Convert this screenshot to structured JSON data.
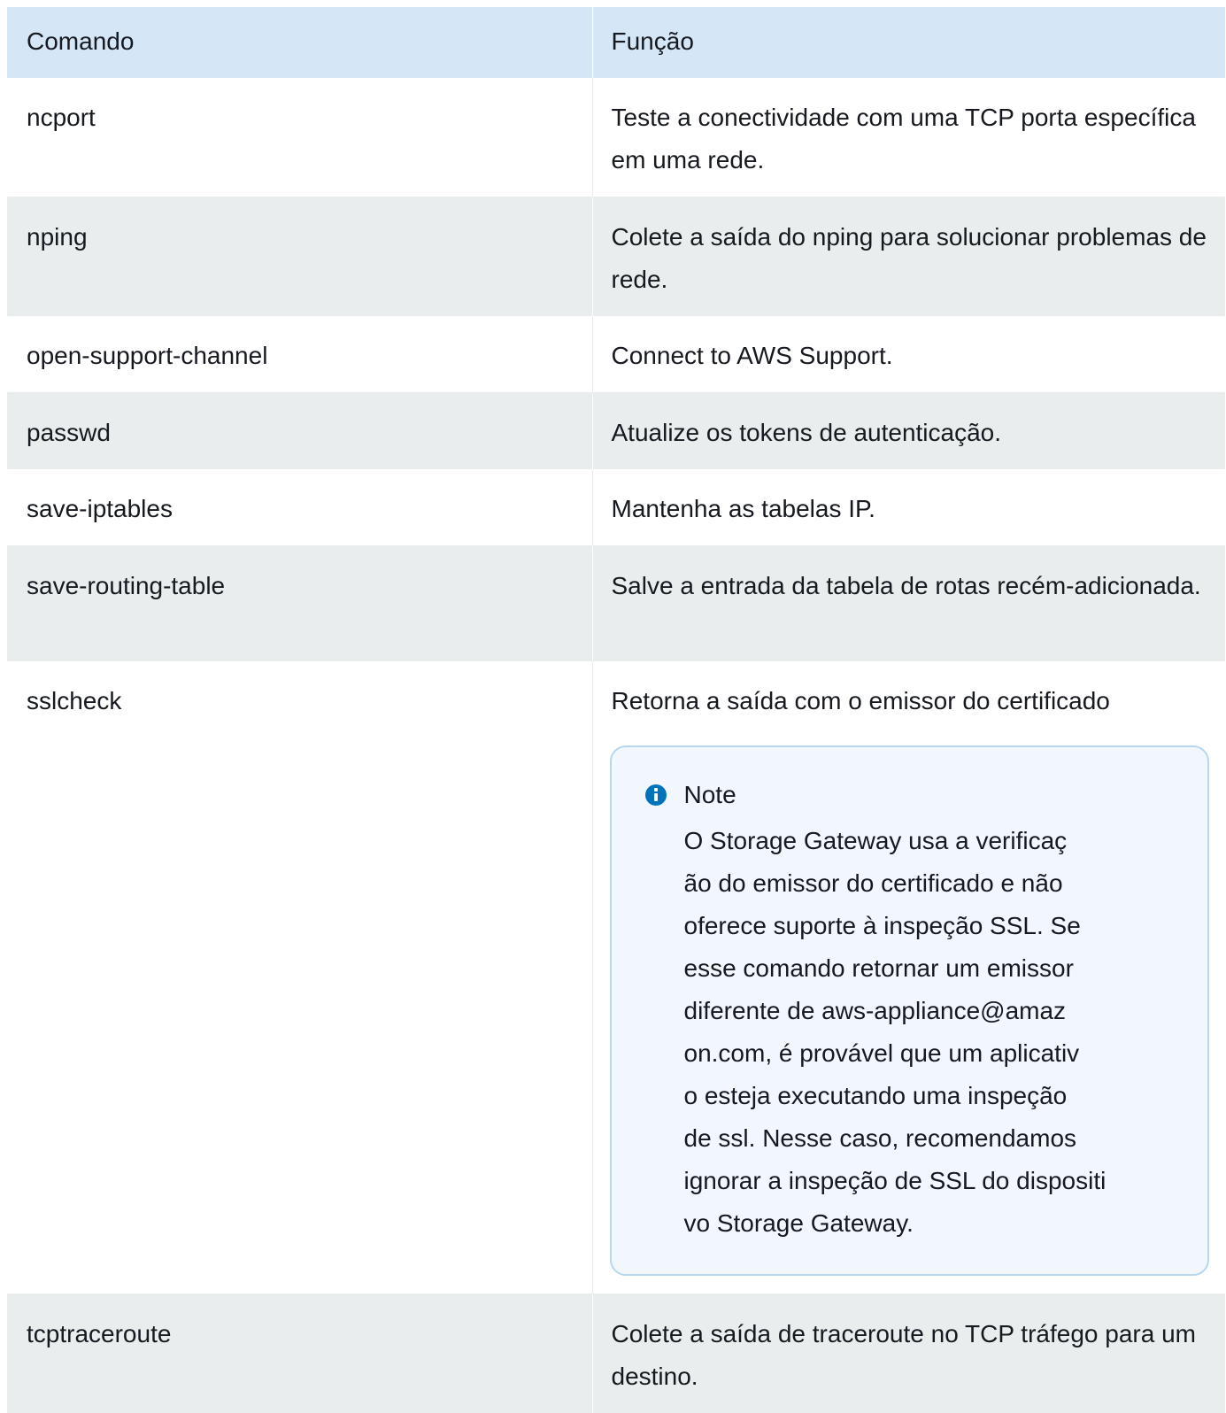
{
  "table": {
    "headers": {
      "command": "Comando",
      "function": "Função"
    },
    "rows": [
      {
        "command": "ncport",
        "function": "Teste a conectividade com uma TCP porta específica em uma rede."
      },
      {
        "command": "nping",
        "function": "Colete a saída do nping para solucionar problemas de rede."
      },
      {
        "command": "open-support-channel",
        "function": "Connect to AWS Support."
      },
      {
        "command": "passwd",
        "function": "Atualize os tokens de autenticação."
      },
      {
        "command": "save-iptables",
        "function": "Mantenha as tabelas IP."
      },
      {
        "command": "save-routing-table",
        "function": "Salve a entrada da tabela de rotas recém-adicionada."
      },
      {
        "command": "sslcheck",
        "function": "Retorna a saída com o emissor do certificado",
        "note": {
          "icon": "info-icon",
          "title": "Note",
          "lines": [
            "O Storage Gateway usa a verificaç",
            "ão do emissor do certificado e não",
            "oferece suporte à inspeção SSL. Se",
            "esse comando retornar um emissor",
            "diferente de aws-appliance@amaz",
            "on.com, é provável que um aplicativ",
            "o esteja executando uma inspeção",
            "de ssl. Nesse caso, recomendamos",
            "ignorar a inspeção de SSL do dispositi",
            "vo Storage Gateway."
          ]
        }
      },
      {
        "command": "tcptraceroute",
        "function": "Colete a saída de traceroute no TCP tráfego para um destino."
      }
    ]
  },
  "colors": {
    "header_bg": "#d5e6f7",
    "stripe_bg": "#eaeded",
    "note_bg": "#f1f7fd",
    "note_border": "#b7d6f0",
    "info_icon": "#0073bb"
  }
}
